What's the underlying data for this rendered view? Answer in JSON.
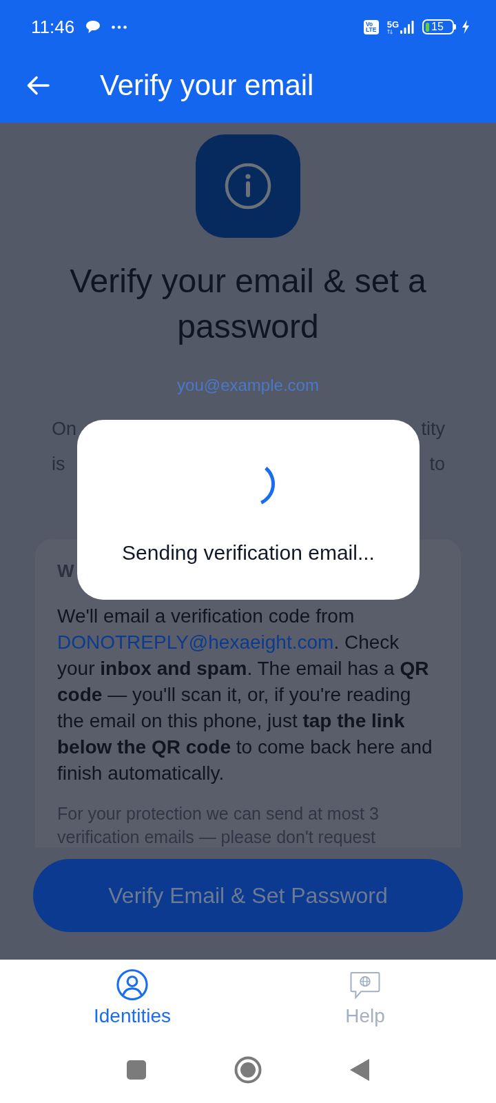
{
  "status_bar": {
    "time": "11:46",
    "volte": [
      "Vo",
      "LTE"
    ],
    "network": "5G",
    "battery": "15"
  },
  "app_bar": {
    "title": "Verify your email"
  },
  "header": {
    "heading": "Verify your email & set a password",
    "email": "you@example.com"
  },
  "intro_lines": [
    {
      "left": "On",
      "right": "tity"
    },
    {
      "left": "is",
      "right": "to"
    }
  ],
  "info_card": {
    "title": "W",
    "body": [
      {
        "kind": "text",
        "text": "We'll email a verification code from "
      },
      {
        "kind": "link",
        "text": "DONOTREPLY@hexaeight.com"
      },
      {
        "kind": "text",
        "text": ". Check your **inbox and spam**. The email has a **QR code** — you'll scan it, or, if you're reading the email on this phone, just **tap the link below the QR code** to come back here and finish automatically."
      }
    ],
    "note": "For your protection we can send at most 3 verification emails — please don't request"
  },
  "primary_button": {
    "label": "Verify Email & Set Password"
  },
  "dialog": {
    "message": "Sending verification email..."
  },
  "bottom_nav": [
    {
      "label": "Identities",
      "selected": true
    },
    {
      "label": "Help",
      "selected": false
    }
  ]
}
